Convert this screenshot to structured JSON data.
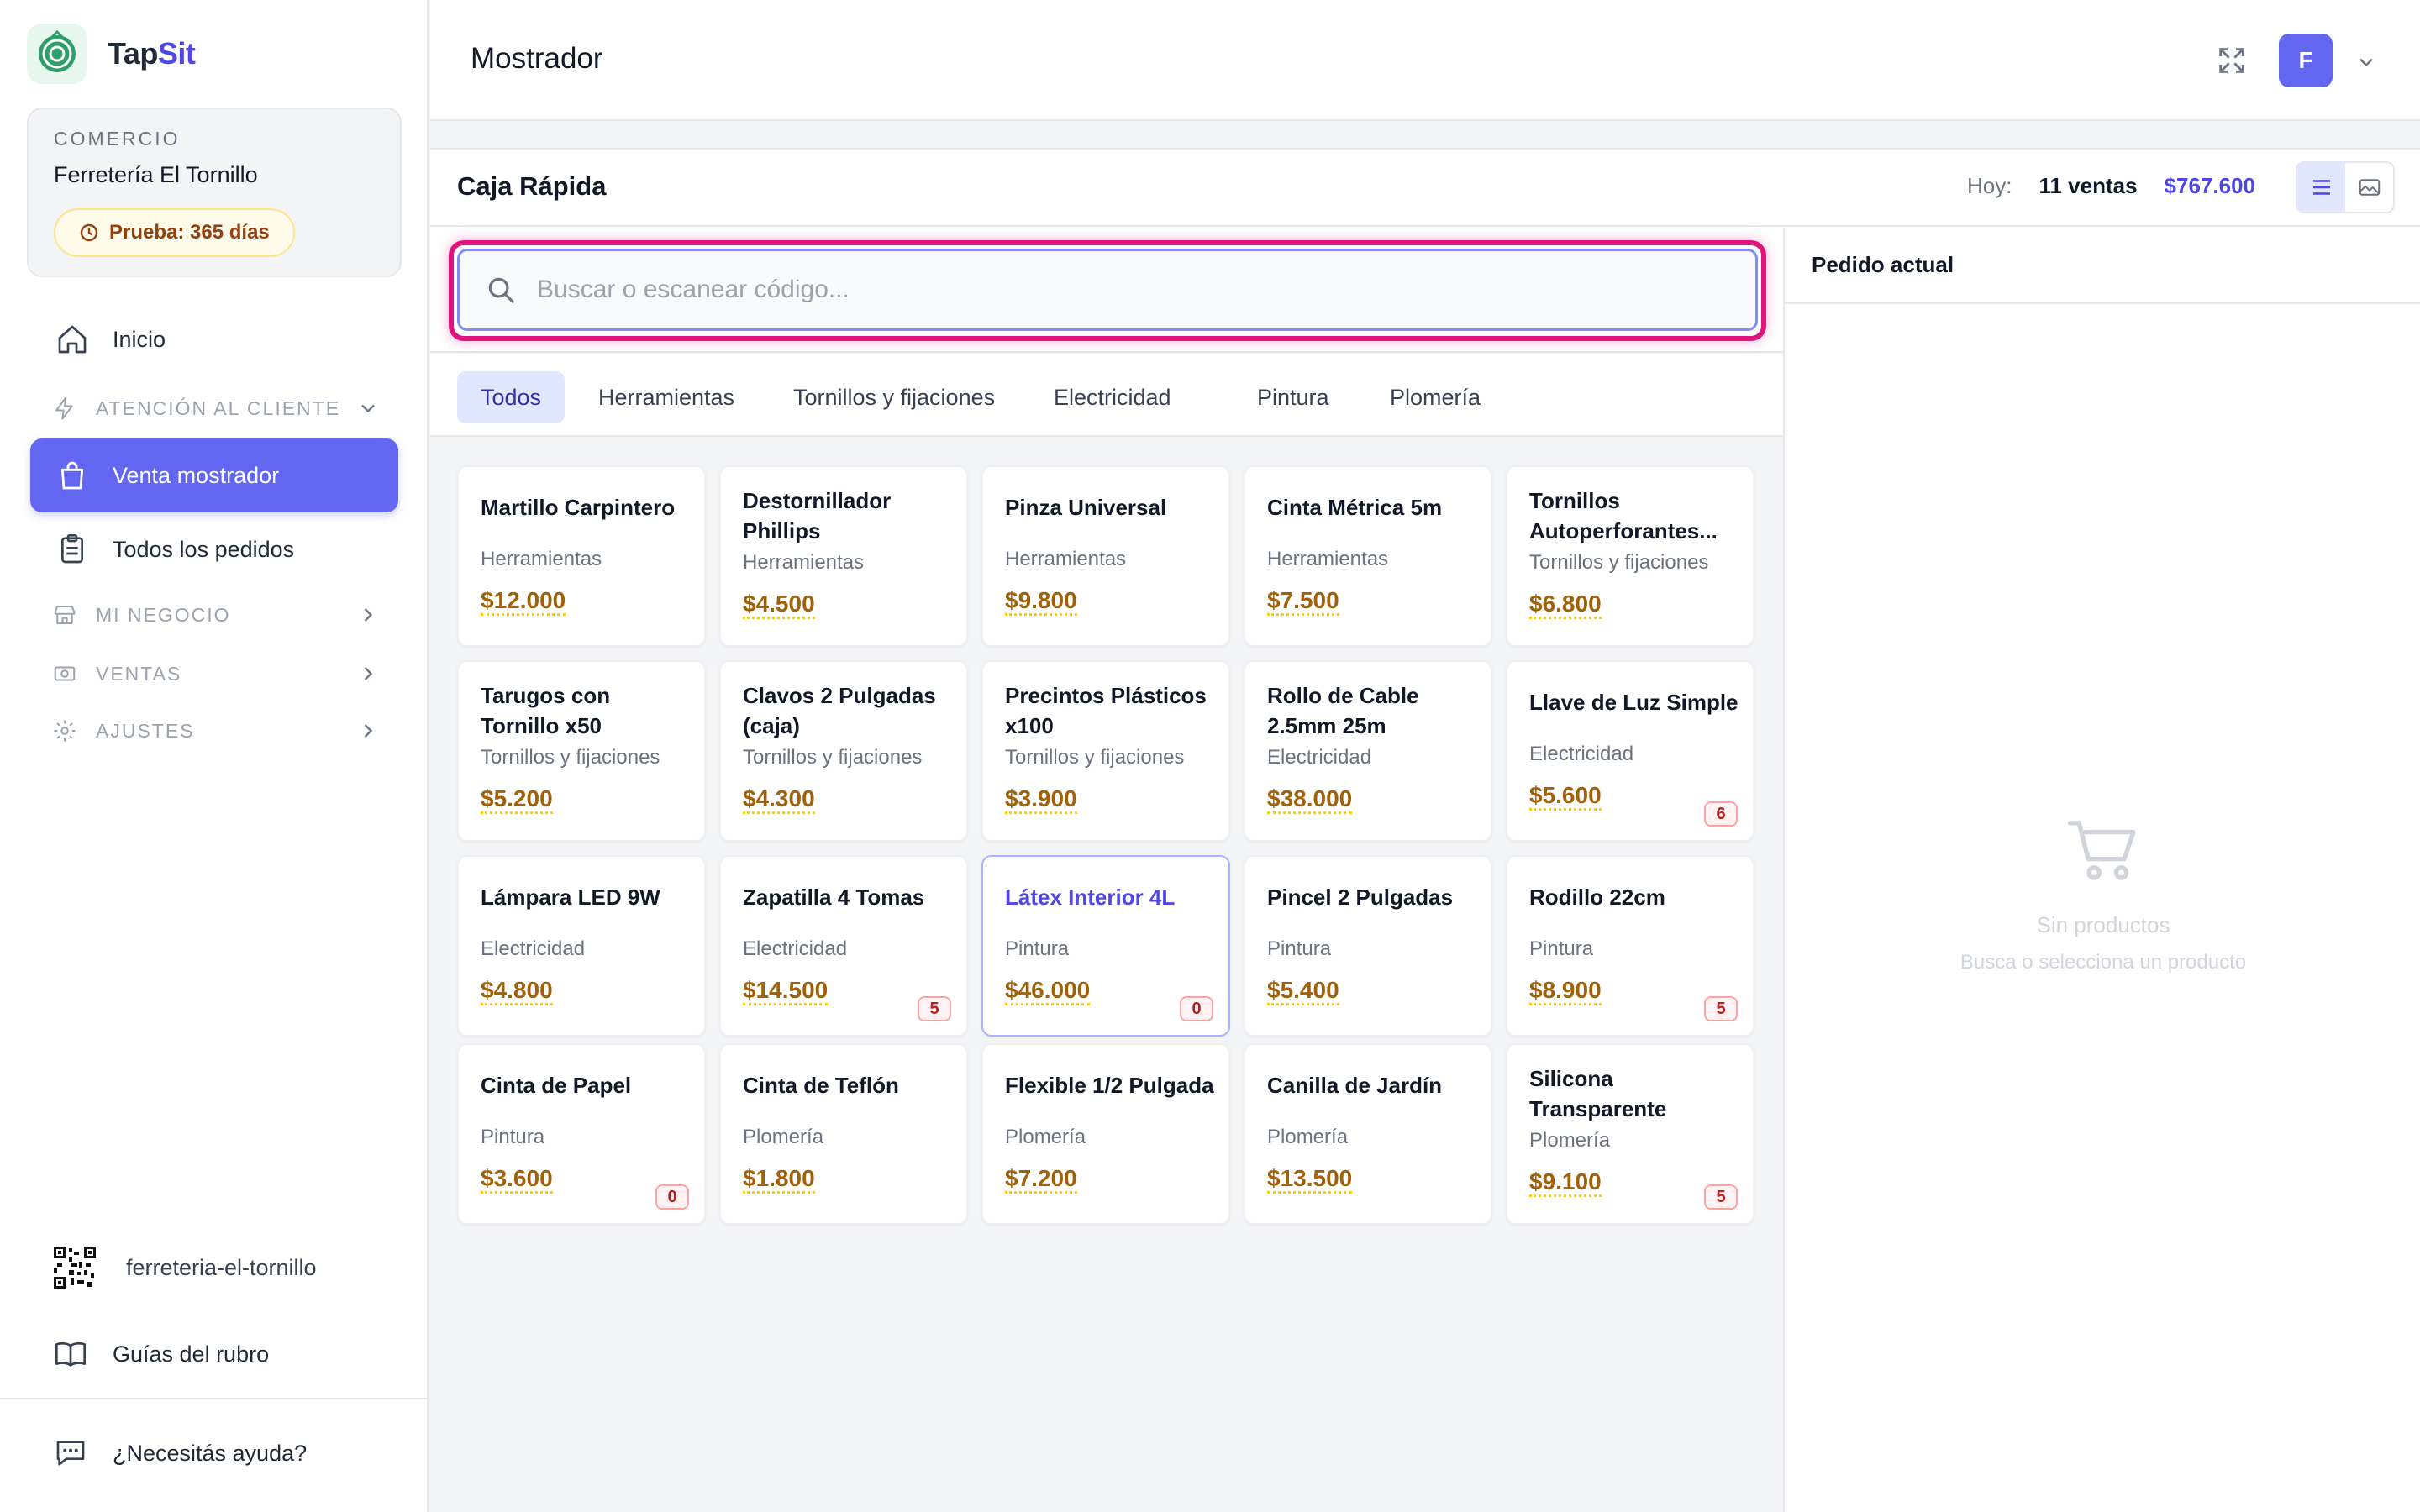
{
  "app": {
    "logo_part1": "Tap",
    "logo_part2": "Sit",
    "logo_icon": "app-logo-icon",
    "accent_color": "#6366f1"
  },
  "sidebar": {
    "shop_label": "COMERCIO",
    "shop_name": "Ferretería El Tornillo",
    "trial_badge": "Prueba: 365 días",
    "items": [
      {
        "label": "Inicio",
        "icon": "home-icon"
      },
      {
        "label": "ATENCIÓN AL CLIENTE",
        "icon": "bolt-icon",
        "type": "section"
      },
      {
        "label": "Venta mostrador",
        "icon": "shopping-bag-icon",
        "active": true
      },
      {
        "label": "Todos los pedidos",
        "icon": "clipboard-icon"
      },
      {
        "label": "MI NEGOCIO",
        "icon": "store-icon",
        "type": "section"
      },
      {
        "label": "VENTAS",
        "icon": "cash-icon",
        "type": "section"
      },
      {
        "label": "AJUSTES",
        "icon": "gear-icon",
        "type": "section"
      }
    ],
    "shop_slug": "ferreteria-el-tornillo",
    "guides_label": "Guías del rubro",
    "help_label": "¿Necesitás ayuda?"
  },
  "header": {
    "title": "Mostrador",
    "avatar_initial": "F"
  },
  "panel": {
    "title": "Caja Rápida",
    "today_label": "Hoy:",
    "sales_count": "11 ventas",
    "sales_total": "$767.600"
  },
  "search": {
    "placeholder": "Buscar o escanear código...",
    "value": ""
  },
  "categories": [
    "Todos",
    "Herramientas",
    "Tornillos y fijaciones",
    "Electricidad",
    "Pintura",
    "Plomería"
  ],
  "active_category": "Todos",
  "products": [
    {
      "name": "Martillo Carpintero",
      "category": "Herramientas",
      "price": "$12.000",
      "stock": null
    },
    {
      "name": "Destornillador Phillips",
      "category": "Herramientas",
      "price": "$4.500",
      "stock": null
    },
    {
      "name": "Pinza Universal",
      "category": "Herramientas",
      "price": "$9.800",
      "stock": null
    },
    {
      "name": "Cinta Métrica 5m",
      "category": "Herramientas",
      "price": "$7.500",
      "stock": null
    },
    {
      "name": "Tornillos Autoperforantes...",
      "category": "Tornillos y fijaciones",
      "price": "$6.800",
      "stock": null
    },
    {
      "name": "Tarugos con Tornillo x50",
      "category": "Tornillos y fijaciones",
      "price": "$5.200",
      "stock": null
    },
    {
      "name": "Clavos 2 Pulgadas (caja)",
      "category": "Tornillos y fijaciones",
      "price": "$4.300",
      "stock": null
    },
    {
      "name": "Precintos Plásticos x100",
      "category": "Tornillos y fijaciones",
      "price": "$3.900",
      "stock": null
    },
    {
      "name": "Rollo de Cable 2.5mm 25m",
      "category": "Electricidad",
      "price": "$38.000",
      "stock": null
    },
    {
      "name": "Llave de Luz Simple",
      "category": "Electricidad",
      "price": "$5.600",
      "stock": "6"
    },
    {
      "name": "Lámpara LED 9W",
      "category": "Electricidad",
      "price": "$4.800",
      "stock": null
    },
    {
      "name": "Zapatilla 4 Tomas",
      "category": "Electricidad",
      "price": "$14.500",
      "stock": "5"
    },
    {
      "name": "Látex Interior 4L",
      "category": "Pintura",
      "price": "$46.000",
      "stock": "0",
      "selected": true
    },
    {
      "name": "Pincel 2 Pulgadas",
      "category": "Pintura",
      "price": "$5.400",
      "stock": null
    },
    {
      "name": "Rodillo 22cm",
      "category": "Pintura",
      "price": "$8.900",
      "stock": "5"
    },
    {
      "name": "Cinta de Papel",
      "category": "Pintura",
      "price": "$3.600",
      "stock": "0"
    },
    {
      "name": "Cinta de Teflón",
      "category": "Plomería",
      "price": "$1.800",
      "stock": null
    },
    {
      "name": "Flexible 1/2 Pulgada",
      "category": "Plomería",
      "price": "$7.200",
      "stock": null
    },
    {
      "name": "Canilla de Jardín",
      "category": "Plomería",
      "price": "$13.500",
      "stock": null
    },
    {
      "name": "Silicona Transparente",
      "category": "Plomería",
      "price": "$9.100",
      "stock": "5"
    }
  ],
  "order": {
    "title": "Pedido actual",
    "empty_title": "Sin productos",
    "empty_subtitle": "Busca o selecciona un producto",
    "empty_icon": "cart-icon"
  }
}
